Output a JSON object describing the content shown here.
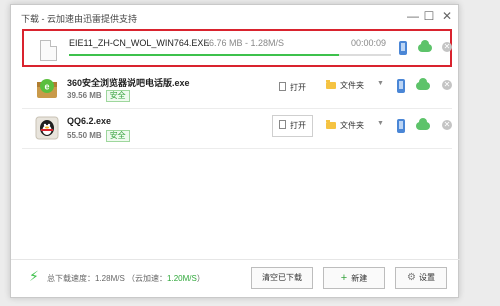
{
  "window": {
    "title": "下载 - 云加速由迅雷提供支持",
    "minimize": "—",
    "maximize": "☐",
    "close": "✕"
  },
  "downloads": [
    {
      "name": "EIE11_ZH-CN_WOL_WIN764.EXE",
      "size": "56.76 MB",
      "speed": "1.28M/S",
      "size_speed": "56.76 MB - 1.28M/S",
      "eta": "00:00:09",
      "progress": 0.84,
      "icon": "file-icon",
      "active": true
    },
    {
      "name": "360安全浏览器说吧电话版.exe",
      "size": "39.56 MB",
      "badge": "安全",
      "open_label": "打开",
      "folder_label": "文件夹",
      "icon": "360-browser-icon"
    },
    {
      "name": "QQ6.2.exe",
      "size": "55.50 MB",
      "badge": "安全",
      "open_label": "打开",
      "folder_label": "文件夹",
      "icon": "qq-penguin-icon"
    }
  ],
  "footer": {
    "speed_prefix": "总下载速度：1.28M/S （云加速：",
    "cloud_speed": "1.20M/S",
    "speed_suffix": "）",
    "clear_label": "清空已下载",
    "new_label": "新建",
    "settings_label": "设置"
  },
  "colors": {
    "accent_green": "#3ec14c",
    "highlight_red": "#d9232e",
    "phone_blue": "#4a86d6",
    "folder_yellow": "#f5c342"
  }
}
